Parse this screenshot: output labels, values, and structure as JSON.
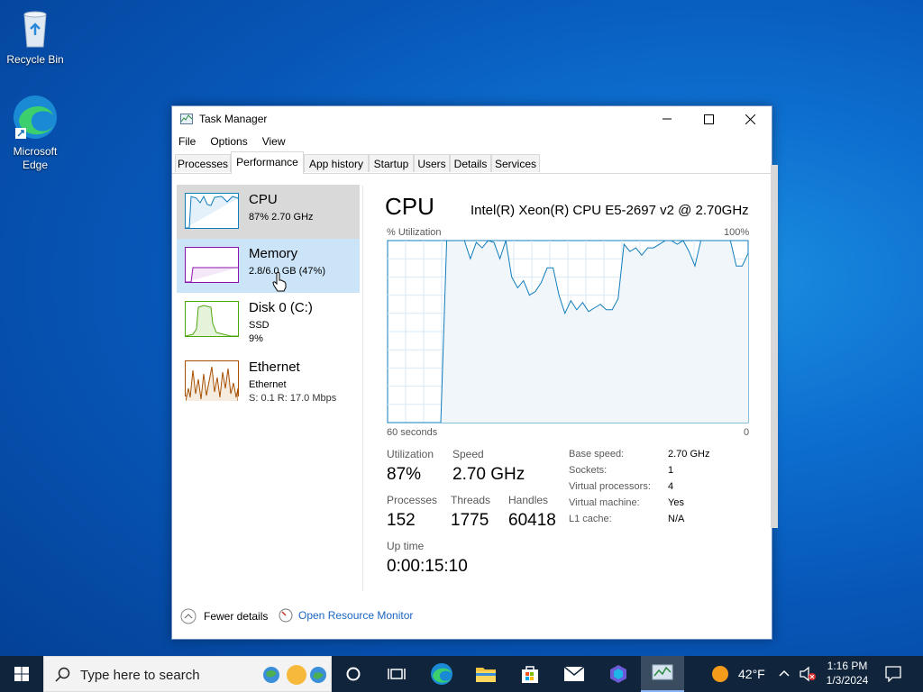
{
  "desktop": {
    "icons": [
      {
        "label": "Recycle Bin"
      },
      {
        "label": "Microsoft\nEdge"
      }
    ]
  },
  "window": {
    "title": "Task Manager",
    "menu": [
      "File",
      "Options",
      "View"
    ],
    "tabs": [
      "Processes",
      "Performance",
      "App history",
      "Startup",
      "Users",
      "Details",
      "Services"
    ],
    "active_tab": "Performance"
  },
  "sidebar": {
    "items": [
      {
        "name": "CPU",
        "line1": "87%  2.70 GHz",
        "line2": "",
        "state": "selected",
        "color": "#117dbb"
      },
      {
        "name": "Memory",
        "line1": "2.8/6.0 GB (47%)",
        "line2": "",
        "state": "hover",
        "color": "#8b12ae"
      },
      {
        "name": "Disk 0 (C:)",
        "line1": "SSD",
        "line2": "9%",
        "state": "",
        "color": "#4da60c"
      },
      {
        "name": "Ethernet",
        "line1": "Ethernet",
        "line2": "S: 0.1  R: 17.0 Mbps",
        "state": "",
        "color": "#a74f01"
      }
    ]
  },
  "cpu": {
    "title": "CPU",
    "model": "Intel(R) Xeon(R) CPU E5-2697 v2 @ 2.70GHz",
    "graph_top_left": "% Utilization",
    "graph_top_right": "100%",
    "graph_bottom_left": "60 seconds",
    "graph_bottom_right": "0",
    "line_color": "#117dbb",
    "stats": {
      "utilization_label": "Utilization",
      "utilization": "87%",
      "speed_label": "Speed",
      "speed": "2.70 GHz",
      "processes_label": "Processes",
      "processes": "152",
      "threads_label": "Threads",
      "threads": "1775",
      "handles_label": "Handles",
      "handles": "60418",
      "uptime_label": "Up time",
      "uptime": "0:00:15:10"
    },
    "details": [
      {
        "k": "Base speed:",
        "v": "2.70 GHz"
      },
      {
        "k": "Sockets:",
        "v": "1"
      },
      {
        "k": "Virtual processors:",
        "v": "4"
      },
      {
        "k": "Virtual machine:",
        "v": "Yes"
      },
      {
        "k": "L1 cache:",
        "v": "N/A"
      }
    ]
  },
  "footer": {
    "fewer_details": "Fewer details",
    "resource_monitor": "Open Resource Monitor"
  },
  "taskbar": {
    "search_placeholder": "Type here to search",
    "weather": "42°F",
    "time": "1:16 PM",
    "date": "1/3/2024"
  },
  "chart_data": {
    "type": "line",
    "title": "",
    "xlabel": "60 seconds",
    "ylabel": "% Utilization",
    "xlim": [
      60,
      0
    ],
    "ylim": [
      0,
      100
    ],
    "x": [
      60,
      59,
      58,
      57,
      56,
      55,
      54,
      53,
      52,
      51,
      50,
      49,
      48,
      47,
      46,
      45,
      44,
      43,
      42,
      41,
      40,
      39,
      38,
      37,
      36,
      35,
      34,
      33,
      32,
      31,
      30,
      29,
      28,
      27,
      26,
      25,
      24,
      23,
      22,
      21,
      20,
      19,
      18,
      17,
      16,
      15,
      14,
      13,
      12,
      11,
      10,
      9,
      8,
      7,
      6,
      5,
      4,
      3,
      2,
      1,
      0
    ],
    "series": [
      {
        "values": [
          0,
          0,
          0,
          0,
          0,
          0,
          0,
          0,
          0,
          0,
          100,
          100,
          100,
          100,
          90,
          99,
          96,
          100,
          99,
          90,
          100,
          80,
          74,
          78,
          70,
          72,
          77,
          85,
          85,
          70,
          60,
          67,
          62,
          66,
          61,
          63,
          65,
          62,
          62,
          68,
          98,
          94,
          96,
          92,
          96,
          96,
          98,
          100,
          100,
          98,
          100,
          94,
          86,
          100,
          100,
          100,
          100,
          100,
          100,
          86,
          86,
          93
        ]
      }
    ],
    "grid": true
  }
}
